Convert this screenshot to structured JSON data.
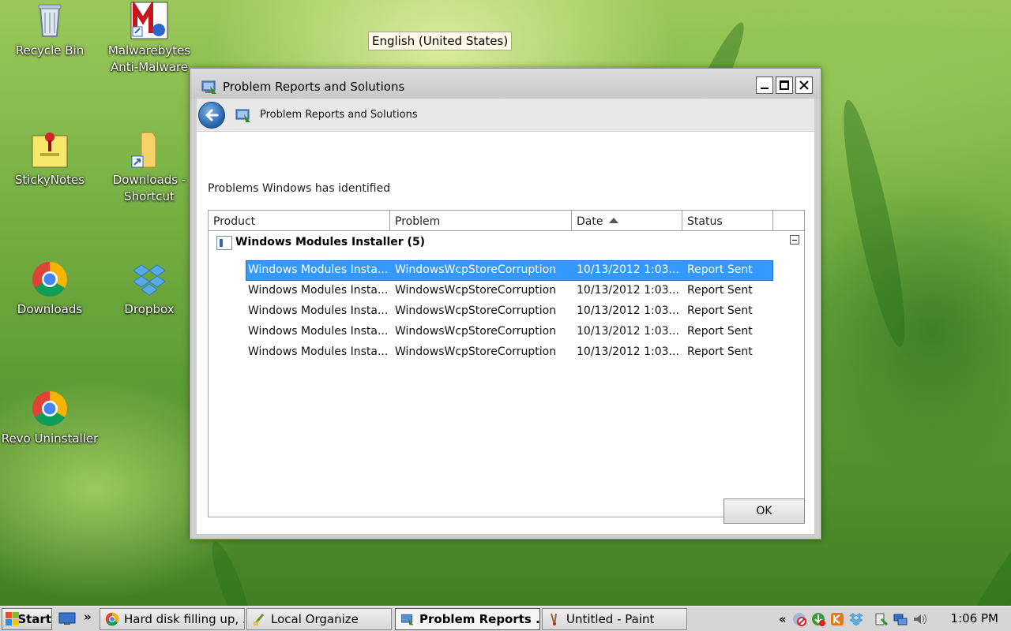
{
  "desktop": {
    "icons": [
      {
        "label": "Recycle Bin",
        "icon": "recycle-bin-icon"
      },
      {
        "label": "Malwarebytes Anti-Malware",
        "icon": "malwarebytes-icon"
      },
      {
        "label": "StickyNotes",
        "icon": "sticky-notes-icon"
      },
      {
        "label": "Downloads - Shortcut",
        "icon": "folder-shortcut-icon"
      },
      {
        "label": "Downloads",
        "icon": "chrome-icon"
      },
      {
        "label": "Dropbox",
        "icon": "dropbox-icon"
      },
      {
        "label": "Revo Uninstaller",
        "icon": "chrome-icon"
      }
    ],
    "language_tooltip": "English (United States)"
  },
  "window": {
    "title": "Problem Reports and Solutions",
    "nav_title": "Problem Reports and Solutions",
    "heading": "Problems Windows has identified",
    "columns": [
      "Product",
      "Problem",
      "Date",
      "Status"
    ],
    "sorted_column": "Date",
    "group": {
      "title": "Windows Modules Installer (5)"
    },
    "rows": [
      {
        "product": "Windows Modules Insta...",
        "problem": "WindowsWcpStoreCorruption",
        "date": "10/13/2012 1:03...",
        "status": "Report Sent",
        "selected": true
      },
      {
        "product": "Windows Modules Insta...",
        "problem": "WindowsWcpStoreCorruption",
        "date": "10/13/2012 1:03...",
        "status": "Report Sent",
        "selected": false
      },
      {
        "product": "Windows Modules Insta...",
        "problem": "WindowsWcpStoreCorruption",
        "date": "10/13/2012 1:03...",
        "status": "Report Sent",
        "selected": false
      },
      {
        "product": "Windows Modules Insta...",
        "problem": "WindowsWcpStoreCorruption",
        "date": "10/13/2012 1:03...",
        "status": "Report Sent",
        "selected": false
      },
      {
        "product": "Windows Modules Insta...",
        "problem": "WindowsWcpStoreCorruption",
        "date": "10/13/2012 1:03...",
        "status": "Report Sent",
        "selected": false
      }
    ],
    "ok_label": "OK"
  },
  "taskbar": {
    "start_label": "Start",
    "overflow_label": "»",
    "tasks": [
      {
        "label": "Hard disk filling up, ...",
        "icon": "chrome-icon",
        "active": false
      },
      {
        "label": "Local Organize",
        "icon": "organize-icon",
        "active": false
      },
      {
        "label": "Problem Reports ...",
        "icon": "problem-reports-icon",
        "active": true
      },
      {
        "label": "Untitled - Paint",
        "icon": "paint-icon",
        "active": false
      }
    ],
    "tray_collapse": "«",
    "clock": "1:06 PM"
  },
  "colors": {
    "selection": "#3399ff",
    "accent_blue": "#1f5fa6"
  }
}
